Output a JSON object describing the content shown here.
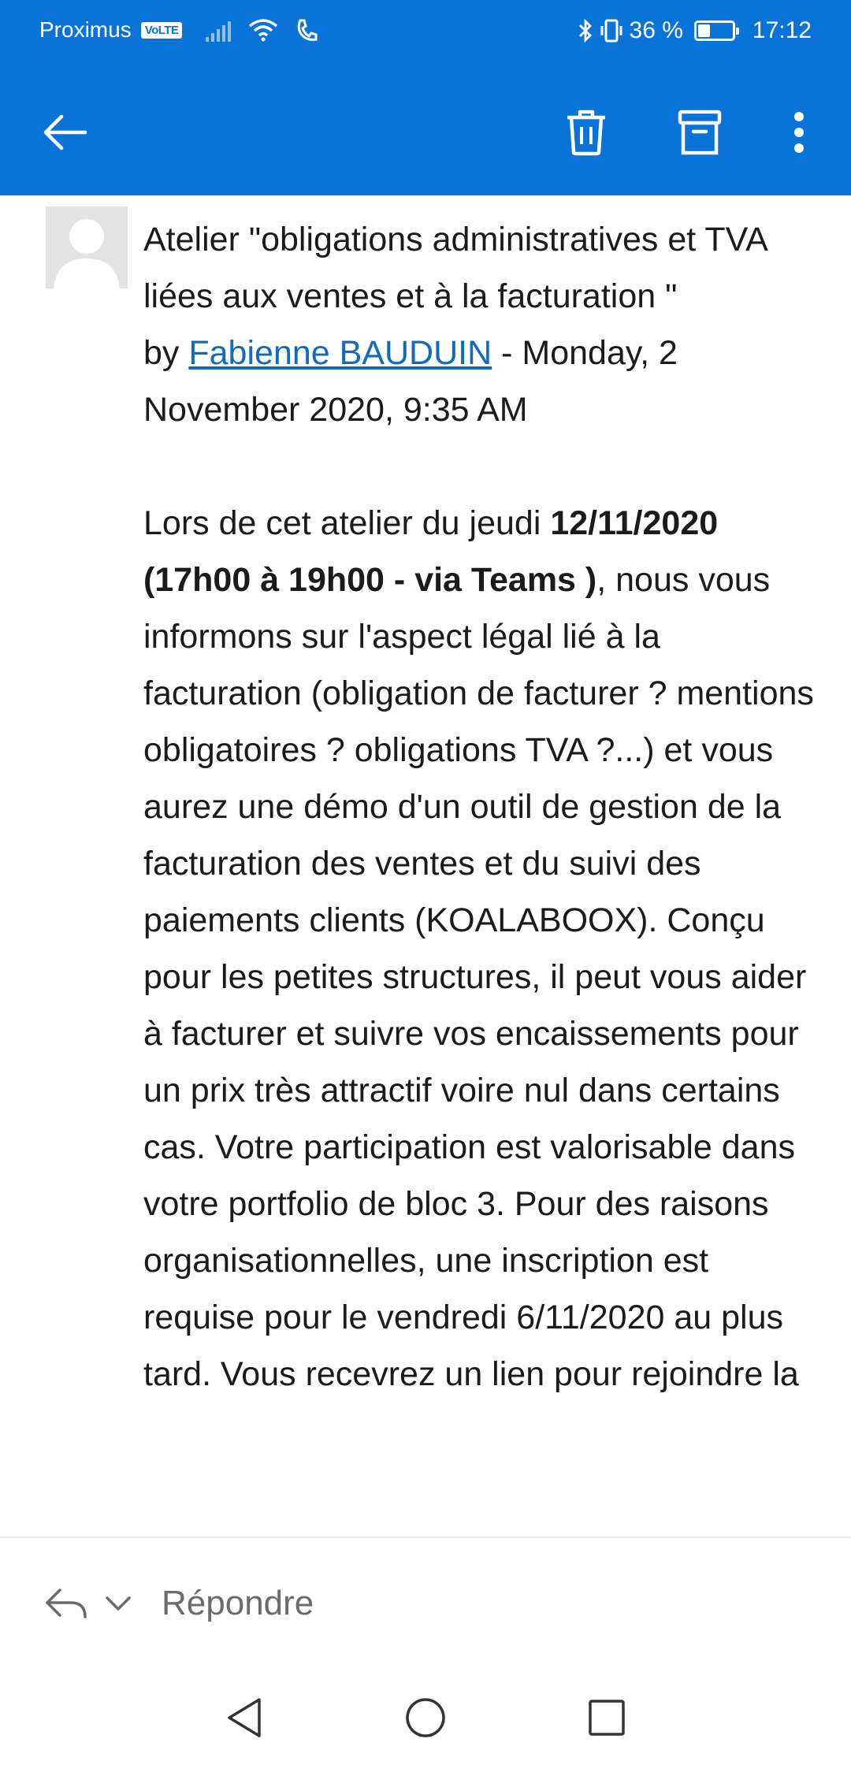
{
  "status_bar": {
    "carrier": "Proximus",
    "volte_badge": "VoLTE",
    "battery_percent": "36 %",
    "battery_level": 0.36,
    "time": "17:12"
  },
  "toolbar": {
    "back_icon": "arrow-left-icon",
    "delete_icon": "trash-icon",
    "archive_icon": "archive-icon",
    "more_icon": "more-vertical-icon",
    "background_color": "#0a73d8"
  },
  "message": {
    "subject": "Atelier \"obligations administratives et TVA liées aux ventes et à la facturation \"",
    "by_label": "by",
    "author": "Fabienne BAUDUIN",
    "date": "- Monday, 2 November 2020, 9:35 AM",
    "body_intro": "Lors de cet atelier du jeudi ",
    "body_bold": "12/11/2020 (17h00 à 19h00 - via Teams )",
    "body_rest": ", nous vous informons sur l'aspect légal lié à la facturation (obligation de facturer ? mentions obligatoires ? obligations TVA ?...) et vous aurez une démo d'un outil de gestion de la facturation des ventes et du suivi des paiements clients (KOALABOOX). Conçu pour les petites structures, il peut vous aider à facturer et suivre vos encaissements pour un prix très attractif voire nul dans certains cas. Votre participation est valorisable dans votre portfolio de bloc 3. Pour des raisons organisationnelles, une inscription est requise pour le vendredi 6/11/2020 au plus tard. Vous recevrez un lien pour rejoindre la"
  },
  "reply_bar": {
    "label": "Répondre"
  },
  "colors": {
    "accent": "#0a73d8",
    "link": "#0f6cbd"
  }
}
